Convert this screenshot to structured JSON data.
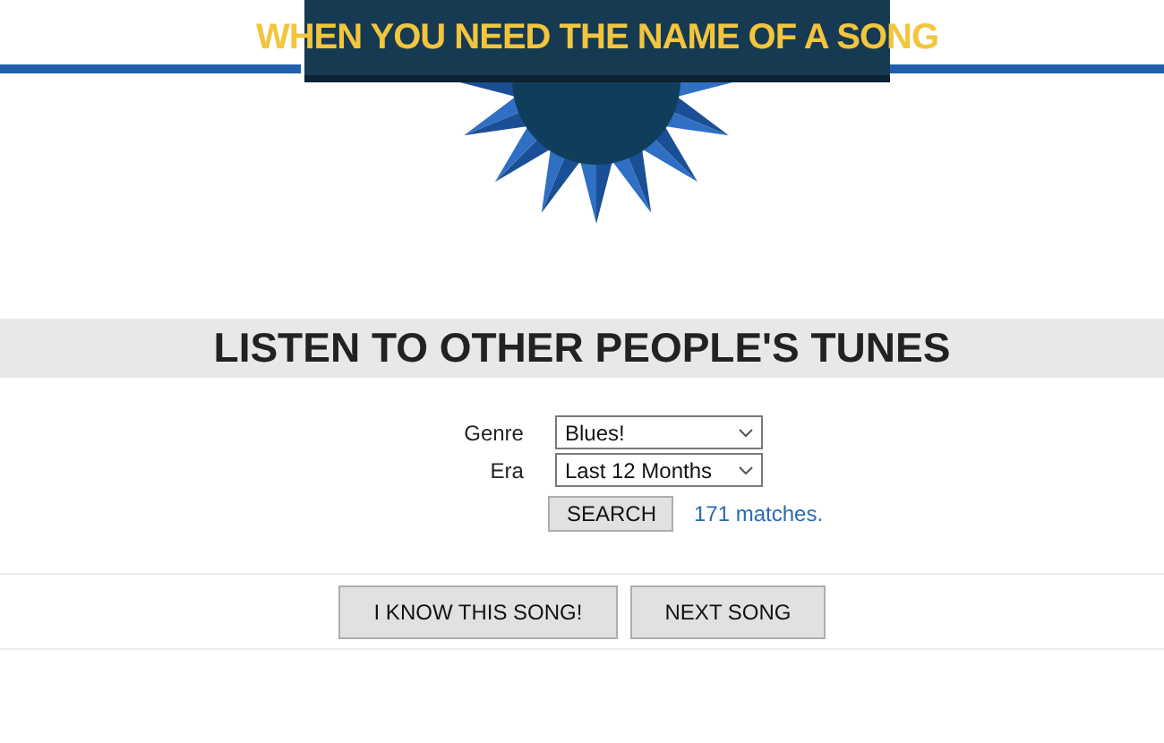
{
  "logo": {
    "text": "WHEN YOU NEED THE NAME OF A SONG"
  },
  "heading": "LISTEN TO OTHER PEOPLE'S TUNES",
  "filters": [
    {
      "label": "Genre",
      "value": "Blues!"
    },
    {
      "label": "Era",
      "value": "Last 12 Months"
    }
  ],
  "search_button": "SEARCH",
  "matches": "171 matches.",
  "buttons": [
    "I KNOW THIS SONG!",
    "NEXT SONG"
  ]
}
